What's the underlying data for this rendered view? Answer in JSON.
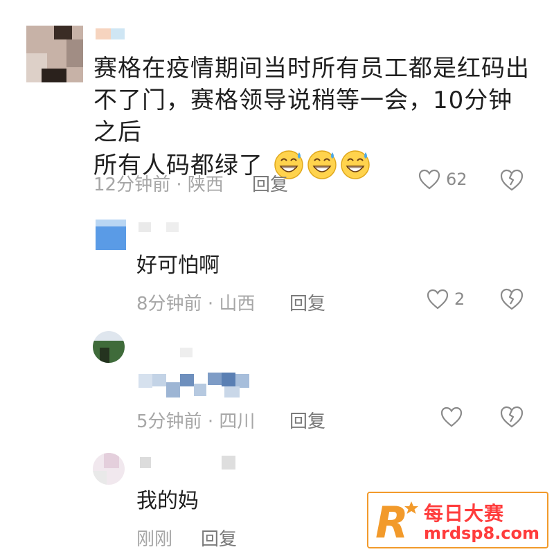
{
  "comments": [
    {
      "text_lines": [
        "赛格在疫情期间当时所有员工都是红码出",
        "不了门，赛格领导说稍等一会，10分钟之后",
        "所有人码都绿了"
      ],
      "emoji_count": 3,
      "emoji_name": "grinning-sweat-emoji",
      "time": "12分钟前",
      "location": "陕西",
      "reply_label": "回复",
      "like_count": "62"
    },
    {
      "text": "好可怕啊",
      "time": "8分钟前",
      "location": "山西",
      "reply_label": "回复",
      "like_count": "2"
    },
    {
      "time": "5分钟前",
      "location": "四川",
      "reply_label": "回复",
      "like_count": ""
    },
    {
      "text": "我的妈",
      "time": "刚刚",
      "reply_label": "回复"
    }
  ],
  "separator": "·",
  "watermark": {
    "logo_letter": "R",
    "title": "每日大赛",
    "url": "mrdsp8.com",
    "accent": "#f29a2b",
    "text_color": "#ff3c3c"
  },
  "colors": {
    "meta": "#a6a6a6",
    "heart": "#8a8a8a"
  }
}
